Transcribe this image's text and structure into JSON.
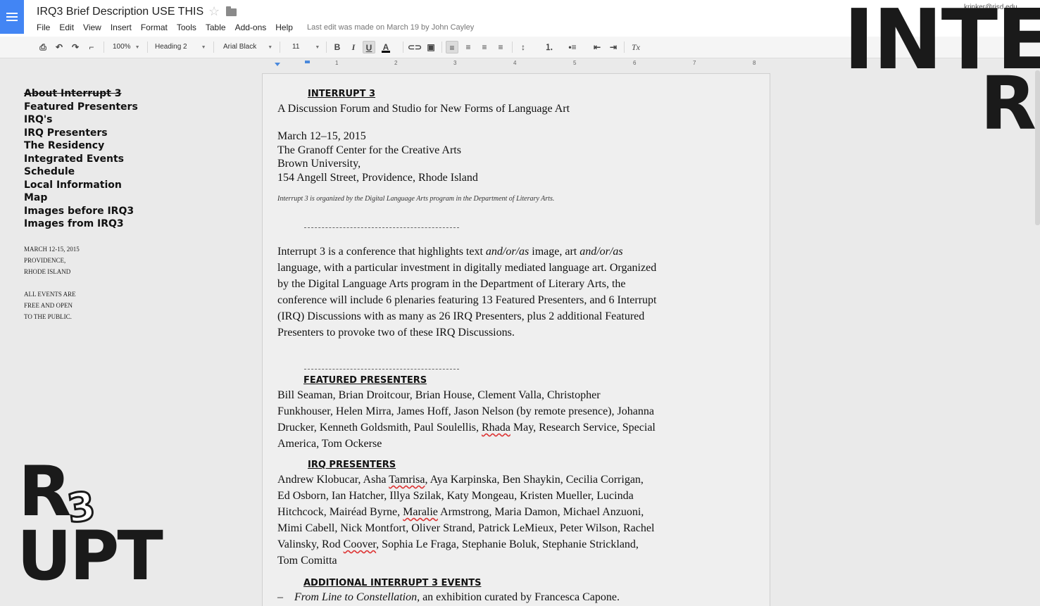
{
  "doc": {
    "title": "IRQ3 Brief Description USE THIS",
    "last_edit": "Last edit was made on March 19 by John Cayley",
    "account": "krinker@risd.edu"
  },
  "menu": [
    "File",
    "Edit",
    "View",
    "Insert",
    "Format",
    "Tools",
    "Table",
    "Add-ons",
    "Help"
  ],
  "toolbar": {
    "zoom": "100%",
    "style": "Heading 2",
    "font": "Arial Black",
    "size": "11",
    "bold": "B",
    "italic": "I",
    "underline": "U",
    "text_color": "A",
    "clear_format": "Tx"
  },
  "ruler": [
    "1",
    "2",
    "3",
    "4",
    "5",
    "6",
    "7",
    "8"
  ],
  "sidebar": {
    "nav": [
      "About Interrupt 3",
      "Featured Presenters",
      "IRQ's",
      "IRQ Presenters",
      "The Residency",
      "Integrated Events",
      "Schedule",
      "Local Information",
      "Map",
      "Images before IRQ3",
      "Images from IRQ3"
    ],
    "info": [
      "MARCH 12-15, 2015",
      "PROVIDENCE,",
      "RHODE ISLAND",
      "",
      "ALL EVENTS ARE",
      "FREE AND OPEN",
      "TO THE PUBLIC."
    ]
  },
  "logo": {
    "top_line": "INTE",
    "top_r": "R",
    "bottom_r": "R",
    "bottom_3": "3",
    "bottom_upt": "UPT"
  },
  "content": {
    "heading1": "INTERRUPT 3",
    "subtitle": "A Discussion Forum and Studio for New Forms of Language Art",
    "dates": "March 12–15, 2015",
    "venue": "The Granoff Center for the Creative Arts",
    "university": "Brown University,",
    "address": "154 Angell Street, Providence, Rhode Island",
    "organized": "Interrupt 3 is organized by the Digital Language Arts program in the  Department of Literary Arts.",
    "intro_p1": "Interrupt 3 is a conference that highlights text ",
    "intro_em1": "and/or/as",
    "intro_p2": " image, art ",
    "intro_em2": "and/or/as",
    "intro_p3": " language, with a particular investment in digitally mediated language art. Organized by the Digital Language Arts program in  the Department of Literary Arts, the conference will include 6 plenaries featuring 13 Featured Presenters, and 6 Interrupt (IRQ) Discussions with as many as 26 IRQ Presenters, plus 2 additional Featured Presenters to provoke two of these IRQ Discussions.",
    "featured_heading": "FEATURED PRESENTERS",
    "featured_a": "Bill Seaman, Brian Droitcour, Brian House, Clement Valla, Christopher Funkhouser, Helen Mirra, James Hoff, Jason Nelson (by remote presence), Johanna Drucker, Kenneth Goldsmith, Paul Soulellis, ",
    "featured_sq": "Rhada",
    "featured_b": " May, Research Service, Special America, Tom Ockerse",
    "irq_heading": "IRQ PRESENTERS",
    "irq_a": "Andrew Klobucar, Asha ",
    "irq_sq1": "Tamrisa",
    "irq_b": ", Aya Karpinska, Ben Shaykin, Cecilia Corrigan, Ed Osborn, Ian Hatcher, Illya Szilak, Katy Mongeau, Kristen Mueller, Lucinda Hitchcock, Mairéad Byrne, ",
    "irq_sq2": "Maralie",
    "irq_c": " Armstrong, Maria Damon, Michael Anzuoni, Mimi Cabell, Nick Montfort, Oliver Strand, Patrick LeMieux, Peter Wilson, Rachel Valinsky, Rod ",
    "irq_sq3": "Coover",
    "irq_d": ", Sophia Le Fraga, Stephanie Boluk, Stephanie Strickland, Tom Comitta",
    "additional_heading": "ADDITIONAL INTERRUPT 3 EVENTS",
    "bullet_dash": "–",
    "bullet_em": "From Line to Constellation,",
    "bullet_text": " an exhibition curated by Francesca Capone."
  }
}
